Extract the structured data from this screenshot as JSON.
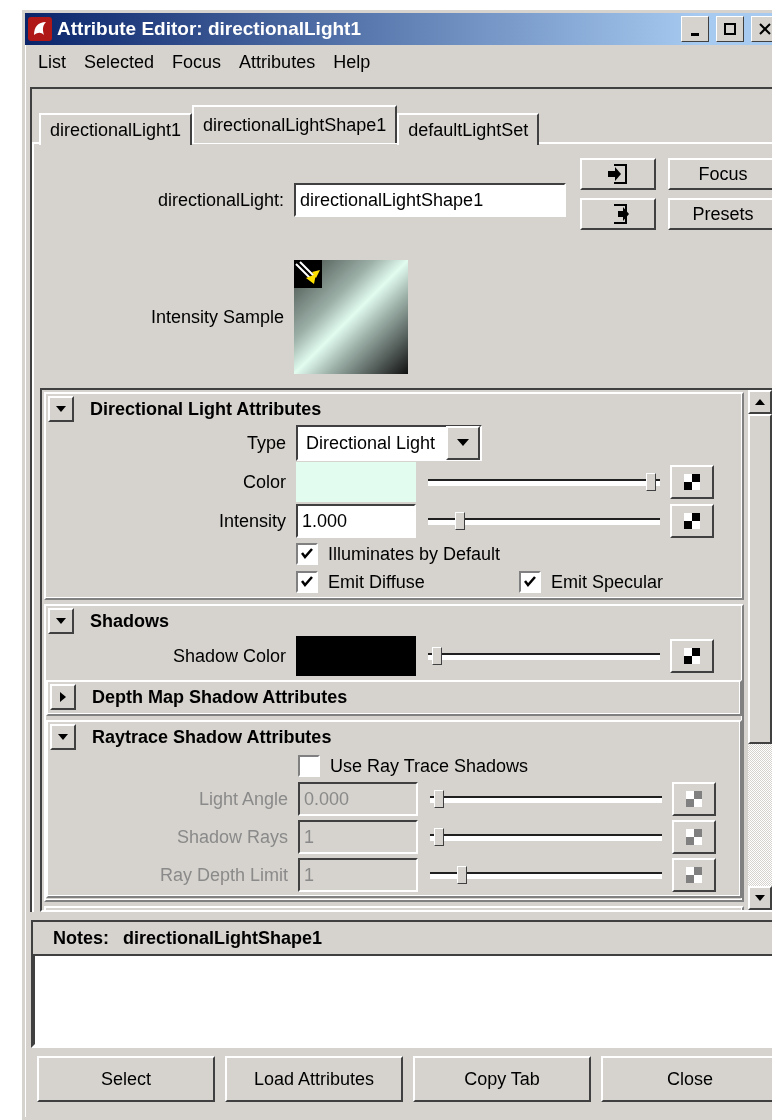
{
  "window": {
    "title": "Attribute Editor: directionalLight1"
  },
  "menu": [
    "List",
    "Selected",
    "Focus",
    "Attributes",
    "Help"
  ],
  "tabs": [
    {
      "label": "directionalLight1",
      "selected": false
    },
    {
      "label": "directionalLightShape1",
      "selected": true
    },
    {
      "label": "defaultLightSet",
      "selected": false
    }
  ],
  "node": {
    "label": "directionalLight:",
    "value": "directionalLightShape1"
  },
  "side_buttons": [
    {
      "kind": "icon-in"
    },
    {
      "kind": "text",
      "label": "Focus"
    },
    {
      "kind": "icon-out"
    },
    {
      "kind": "text",
      "label": "Presets"
    }
  ],
  "sample": {
    "label": "Intensity Sample"
  },
  "sections": [
    {
      "title": "Directional Light Attributes",
      "expanded": true,
      "rows": [
        {
          "kind": "dropdown",
          "label": "Type",
          "value": "Directional Light"
        },
        {
          "kind": "color",
          "label": "Color",
          "color": "#e2fcf0",
          "level": 0.98
        },
        {
          "kind": "number",
          "label": "Intensity",
          "value": "1.000",
          "level": 0.12,
          "disabled": false
        },
        {
          "kind": "checks",
          "items": [
            {
              "label": "Illuminates by Default",
              "checked": true
            }
          ]
        },
        {
          "kind": "checks",
          "items": [
            {
              "label": "Emit Diffuse",
              "checked": true
            },
            {
              "label": "Emit Specular",
              "checked": true
            }
          ]
        }
      ]
    },
    {
      "title": "Shadows",
      "expanded": true,
      "rows": [
        {
          "kind": "color",
          "label": "Shadow Color",
          "color": "#000000",
          "level": 0.02
        }
      ],
      "children": [
        {
          "title": "Depth Map Shadow Attributes",
          "expanded": false
        },
        {
          "title": "Raytrace Shadow Attributes",
          "expanded": true,
          "rows": [
            {
              "kind": "checks",
              "items": [
                {
                  "label": "Use Ray Trace Shadows",
                  "checked": false
                }
              ]
            },
            {
              "kind": "number",
              "label": "Light Angle",
              "value": "0.000",
              "level": 0.02,
              "disabled": true
            },
            {
              "kind": "number",
              "label": "Shadow Rays",
              "value": "1",
              "level": 0.02,
              "disabled": true
            },
            {
              "kind": "number",
              "label": "Ray Depth Limit",
              "value": "1",
              "level": 0.12,
              "disabled": true
            }
          ]
        }
      ]
    }
  ],
  "notes": {
    "label": "Notes:",
    "node": "directionalLightShape1"
  },
  "buttons": [
    "Select",
    "Load Attributes",
    "Copy Tab",
    "Close"
  ]
}
